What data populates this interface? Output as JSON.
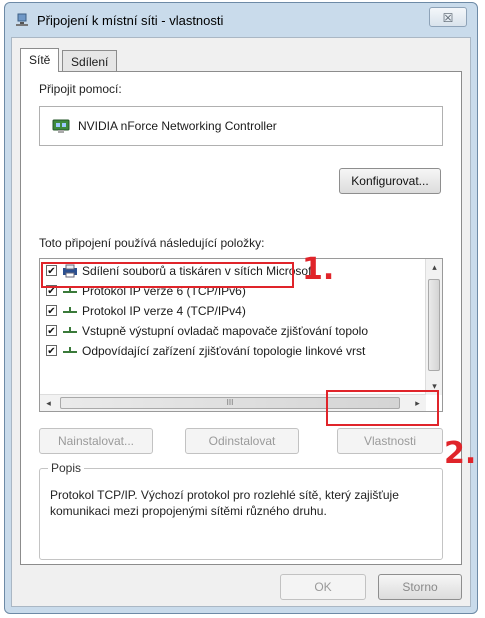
{
  "window": {
    "title": "Připojení k místní síti - vlastnosti",
    "close_glyph": "☒"
  },
  "tabs": [
    {
      "label": "Sítě",
      "active": true
    },
    {
      "label": "Sdílení",
      "active": false
    }
  ],
  "connect_using": {
    "label": "Připojit pomocí:",
    "adapter": "NVIDIA nForce Networking Controller",
    "configure_button": "Konfigurovat..."
  },
  "items_label": "Toto připojení používá následující položky:",
  "items": [
    {
      "label": "Sdílení souborů a tiskáren v sítích Microsoft",
      "checked": true,
      "icon": "file-print-sharing-icon"
    },
    {
      "label": "Protokol IP verze 6 (TCP/IPv6)",
      "checked": true,
      "icon": "network-protocol-icon"
    },
    {
      "label": "Protokol IP verze 4 (TCP/IPv4)",
      "checked": true,
      "icon": "network-protocol-icon"
    },
    {
      "label": "Vstupně výstupní ovladač mapovače zjišťování topolo",
      "checked": true,
      "icon": "network-protocol-icon"
    },
    {
      "label": "Odpovídající zařízení zjišťování topologie linkové vrst",
      "checked": true,
      "icon": "network-protocol-icon"
    }
  ],
  "scrollbar": {
    "left_arrow": "◂",
    "right_arrow": "▸",
    "up_arrow": "▴",
    "down_arrow": "▾",
    "grip": "III"
  },
  "buttons": {
    "install": "Nainstalovat...",
    "uninstall": "Odinstalovat",
    "properties": "Vlastnosti"
  },
  "description": {
    "legend": "Popis",
    "text": "Protokol TCP/IP. Výchozí protokol pro rozlehlé sítě, který zajišťuje komunikaci mezi propojenými sítěmi různého druhu."
  },
  "footer": {
    "ok": "OK",
    "cancel": "Storno"
  },
  "annotations": {
    "step1": "1.",
    "step2": "2."
  },
  "colors": {
    "annotation": "#e0242a",
    "title_bar": "#c9dbeb"
  }
}
